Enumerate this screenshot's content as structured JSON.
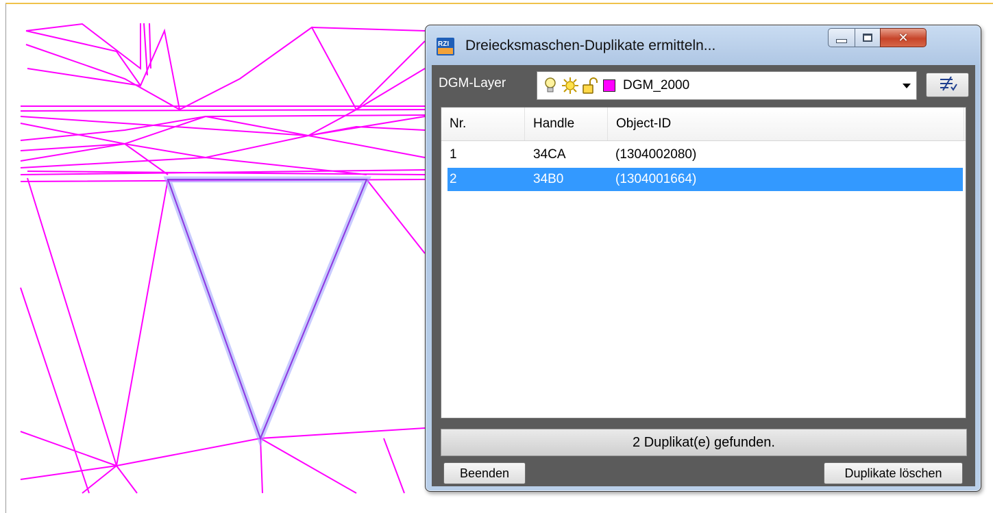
{
  "dialog": {
    "title": "Dreiecksmaschen-Duplikate ermitteln...",
    "app_icon": "rzi-app-icon",
    "layer_label": "DGM-Layer",
    "layer": {
      "name": "DGM_2000",
      "color": "#ff00ff",
      "icons": [
        "bulb-icon",
        "sun-icon",
        "unlock-icon"
      ]
    },
    "layer_button_icon": "layer-select-icon",
    "columns": [
      "Nr.",
      "Handle",
      "Object-ID"
    ],
    "rows": [
      {
        "nr": "1",
        "handle": "34CA",
        "object_id": "(1304002080)",
        "selected": false
      },
      {
        "nr": "2",
        "handle": "34B0",
        "object_id": "(1304001664)",
        "selected": true
      }
    ],
    "status": "2 Duplikat(e) gefunden.",
    "buttons": {
      "close_label": "Beenden",
      "delete_label": "Duplikate löschen"
    }
  },
  "colors": {
    "mesh_lines": "#ff00ff",
    "highlight": "#7b7bf0",
    "selection": "#3399ff",
    "client_bg": "#5b5b5b"
  }
}
